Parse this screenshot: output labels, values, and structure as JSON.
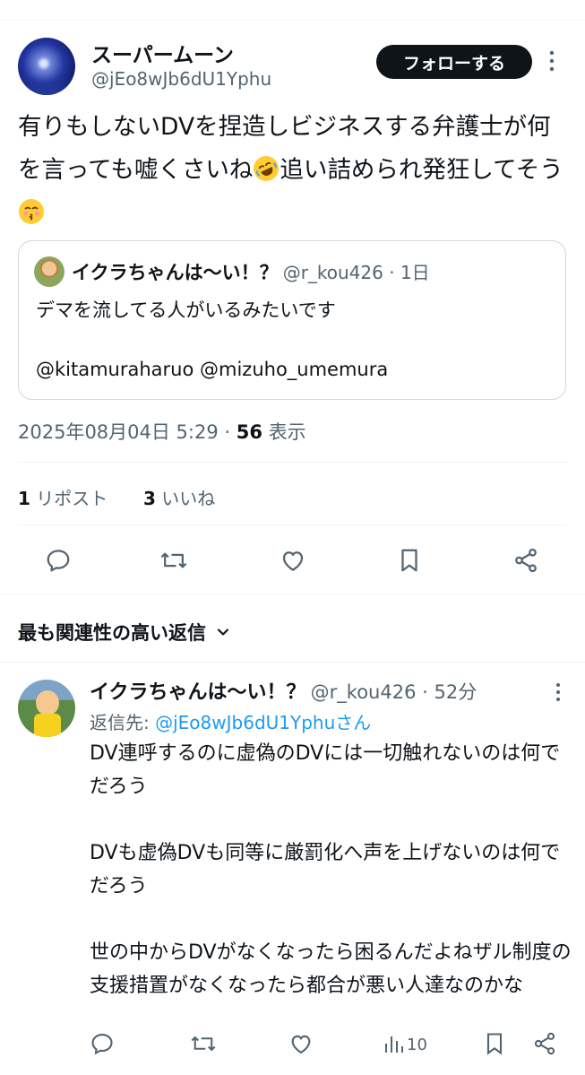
{
  "post": {
    "author_name": "スーパームーン",
    "author_handle": "@jEo8wJb6dU1Yphu",
    "follow_label": "フォローする",
    "text_part1": "有りもしないDVを捏造しビジネスする弁護士が何を言っても嘘くさいね",
    "text_part2": "追い詰められ発狂してそう",
    "emoji1": "rolling-on-floor-laughing",
    "emoji2": "kissing-face",
    "timestamp": "2025年08月04日 5:29",
    "views_count": "56",
    "views_label": "表示",
    "repost_count": "1",
    "repost_label": "リポスト",
    "like_count": "3",
    "like_label": "いいね"
  },
  "quoted": {
    "author_name": "イクラちゃんは〜い！？",
    "author_handle": "@r_kou426",
    "age": "1日",
    "line1": "デマを流してる人がいるみたいです",
    "line2": "@kitamuraharuo  @mizuho_umemura"
  },
  "replies_sort": {
    "label": "最も関連性の高い返信"
  },
  "reply": {
    "author_name": "イクラちゃんは〜い！？",
    "author_handle": "@r_kou426",
    "age": "52分",
    "reply_to_prefix": "返信先: ",
    "reply_to_handle": "@jEo8wJb6dU1Yphuさん",
    "body": "DV連呼するのに虚偽のDVには一切触れないのは何でだろう\n\nDVも虚偽DVも同等に厳罰化へ声を上げないのは何でだろう\n\n世の中からDVがなくなったら困るんだよねザル制度の支援措置がなくなったら都合が悪い人達なのかな",
    "views": "10"
  },
  "colors": {
    "text": "#0f1419",
    "secondary": "#536471",
    "link": "#1d9bf0",
    "border": "#cfd9de",
    "divider": "#eff3f4"
  }
}
